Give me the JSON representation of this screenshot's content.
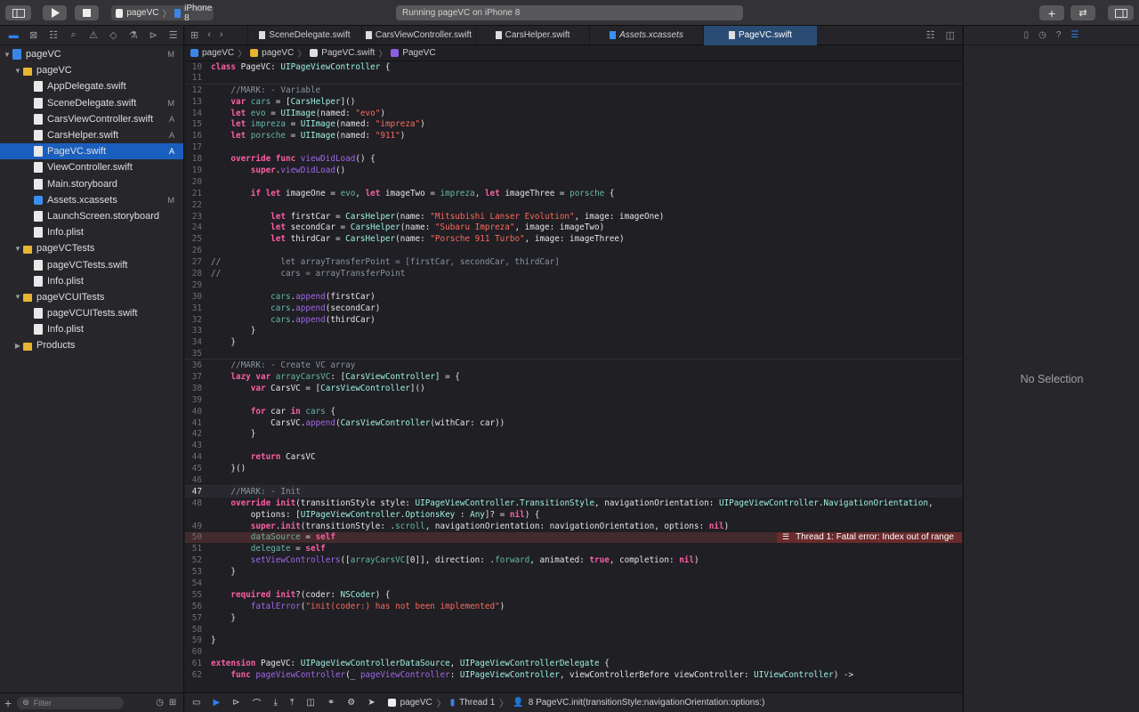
{
  "toolbar": {
    "scheme_target": "pageVC",
    "scheme_device": "iPhone 8",
    "activity_text": "Running pageVC on iPhone 8"
  },
  "navigator": {
    "tree": [
      {
        "label": "pageVC",
        "badge": "M",
        "kind": "project",
        "depth": 0,
        "disclosure": "▼"
      },
      {
        "label": "pageVC",
        "badge": "",
        "kind": "folder",
        "depth": 1,
        "disclosure": "▼"
      },
      {
        "label": "AppDelegate.swift",
        "badge": "",
        "kind": "file",
        "depth": 2
      },
      {
        "label": "SceneDelegate.swift",
        "badge": "M",
        "kind": "file",
        "depth": 2
      },
      {
        "label": "CarsViewController.swift",
        "badge": "A",
        "kind": "file",
        "depth": 2
      },
      {
        "label": "CarsHelper.swift",
        "badge": "A",
        "kind": "file",
        "depth": 2
      },
      {
        "label": "PageVC.swift",
        "badge": "A",
        "kind": "file",
        "depth": 2,
        "selected": true
      },
      {
        "label": "ViewController.swift",
        "badge": "",
        "kind": "file",
        "depth": 2
      },
      {
        "label": "Main.storyboard",
        "badge": "",
        "kind": "file",
        "depth": 2
      },
      {
        "label": "Assets.xcassets",
        "badge": "M",
        "kind": "asset",
        "depth": 2
      },
      {
        "label": "LaunchScreen.storyboard",
        "badge": "",
        "kind": "file",
        "depth": 2
      },
      {
        "label": "Info.plist",
        "badge": "",
        "kind": "file",
        "depth": 2
      },
      {
        "label": "pageVCTests",
        "badge": "",
        "kind": "folder",
        "depth": 1,
        "disclosure": "▼"
      },
      {
        "label": "pageVCTests.swift",
        "badge": "",
        "kind": "file",
        "depth": 2
      },
      {
        "label": "Info.plist",
        "badge": "",
        "kind": "file",
        "depth": 2
      },
      {
        "label": "pageVCUITests",
        "badge": "",
        "kind": "folder",
        "depth": 1,
        "disclosure": "▼"
      },
      {
        "label": "pageVCUITests.swift",
        "badge": "",
        "kind": "file",
        "depth": 2
      },
      {
        "label": "Info.plist",
        "badge": "",
        "kind": "file",
        "depth": 2
      },
      {
        "label": "Products",
        "badge": "",
        "kind": "folder",
        "depth": 1,
        "disclosure": "▶"
      }
    ],
    "filter_placeholder": "Filter"
  },
  "tabs": [
    {
      "label": "SceneDelegate.swift",
      "active": false
    },
    {
      "label": "CarsViewController.swift",
      "active": false
    },
    {
      "label": "CarsHelper.swift",
      "active": false
    },
    {
      "label": "Assets.xcassets",
      "active": false
    },
    {
      "label": "PageVC.swift",
      "active": true
    }
  ],
  "jumpbar": [
    "pageVC",
    "pageVC",
    "PageVC.swift",
    "PageVC"
  ],
  "code": {
    "current_line": 47,
    "error_line": 50,
    "error_message": "Thread 1: Fatal error: Index out of range",
    "lines": [
      {
        "n": 10,
        "t": "class PageVC: UIPageViewController {"
      },
      {
        "n": 11,
        "t": ""
      },
      {
        "n": 12,
        "t": "    //MARK: - Variable"
      },
      {
        "n": 13,
        "t": "    var cars = [CarsHelper]()"
      },
      {
        "n": 14,
        "t": "    let evo = UIImage(named: \"evo\")"
      },
      {
        "n": 15,
        "t": "    let impreza = UIImage(named: \"impreza\")"
      },
      {
        "n": 16,
        "t": "    let porsche = UIImage(named: \"911\")"
      },
      {
        "n": 17,
        "t": ""
      },
      {
        "n": 18,
        "t": "    override func viewDidLoad() {"
      },
      {
        "n": 19,
        "t": "        super.viewDidLoad()"
      },
      {
        "n": 20,
        "t": ""
      },
      {
        "n": 21,
        "t": "        if let imageOne = evo, let imageTwo = impreza, let imageThree = porsche {"
      },
      {
        "n": 22,
        "t": ""
      },
      {
        "n": 23,
        "t": "            let firstCar = CarsHelper(name: \"Mitsubishi Lanser Evolution\", image: imageOne)"
      },
      {
        "n": 24,
        "t": "            let secondCar = CarsHelper(name: \"Subaru Impreza\", image: imageTwo)"
      },
      {
        "n": 25,
        "t": "            let thirdCar = CarsHelper(name: \"Porsche 911 Turbo\", image: imageThree)"
      },
      {
        "n": 26,
        "t": ""
      },
      {
        "n": 27,
        "t": "//            let arrayTransferPoint = [firstCar, secondCar, thirdCar]"
      },
      {
        "n": 28,
        "t": "//            cars = arrayTransferPoint"
      },
      {
        "n": 29,
        "t": ""
      },
      {
        "n": 30,
        "t": "            cars.append(firstCar)"
      },
      {
        "n": 31,
        "t": "            cars.append(secondCar)"
      },
      {
        "n": 32,
        "t": "            cars.append(thirdCar)"
      },
      {
        "n": 33,
        "t": "        }"
      },
      {
        "n": 34,
        "t": "    }"
      },
      {
        "n": 35,
        "t": ""
      },
      {
        "n": 36,
        "t": "    //MARK: - Create VC array"
      },
      {
        "n": 37,
        "t": "    lazy var arrayCarsVC: [CarsViewController] = {"
      },
      {
        "n": 38,
        "t": "        var CarsVC = [CarsViewController]()"
      },
      {
        "n": 39,
        "t": ""
      },
      {
        "n": 40,
        "t": "        for car in cars {"
      },
      {
        "n": 41,
        "t": "            CarsVC.append(CarsViewController(withCar: car))"
      },
      {
        "n": 42,
        "t": "        }"
      },
      {
        "n": 43,
        "t": ""
      },
      {
        "n": 44,
        "t": "        return CarsVC"
      },
      {
        "n": 45,
        "t": "    }()"
      },
      {
        "n": 46,
        "t": ""
      },
      {
        "n": 47,
        "t": "    //MARK: - Init"
      },
      {
        "n": 48,
        "t": "    override init(transitionStyle style: UIPageViewController.TransitionStyle, navigationOrientation: UIPageViewController.NavigationOrientation,"
      },
      {
        "n": null,
        "t": "        options: [UIPageViewController.OptionsKey : Any]? = nil) {"
      },
      {
        "n": 49,
        "t": "        super.init(transitionStyle: .scroll, navigationOrientation: navigationOrientation, options: nil)"
      },
      {
        "n": 50,
        "t": "        dataSource = self"
      },
      {
        "n": 51,
        "t": "        delegate = self"
      },
      {
        "n": 52,
        "t": "        setViewControllers([arrayCarsVC[0]], direction: .forward, animated: true, completion: nil)"
      },
      {
        "n": 53,
        "t": "    }"
      },
      {
        "n": 54,
        "t": ""
      },
      {
        "n": 55,
        "t": "    required init?(coder: NSCoder) {"
      },
      {
        "n": 56,
        "t": "        fatalError(\"init(coder:) has not been implemented\")"
      },
      {
        "n": 57,
        "t": "    }"
      },
      {
        "n": 58,
        "t": ""
      },
      {
        "n": 59,
        "t": "}"
      },
      {
        "n": 60,
        "t": ""
      },
      {
        "n": 61,
        "t": "extension PageVC: UIPageViewControllerDataSource, UIPageViewControllerDelegate {"
      },
      {
        "n": 62,
        "t": "    func pageViewController(_ pageViewController: UIPageViewController, viewControllerBefore viewController: UIViewController) ->"
      }
    ]
  },
  "debugbar": {
    "target": "pageVC",
    "thread": "Thread 1",
    "frame": "8 PageVC.init(transitionStyle:navigationOrientation:options:)"
  },
  "inspector": {
    "empty_text": "No Selection"
  }
}
